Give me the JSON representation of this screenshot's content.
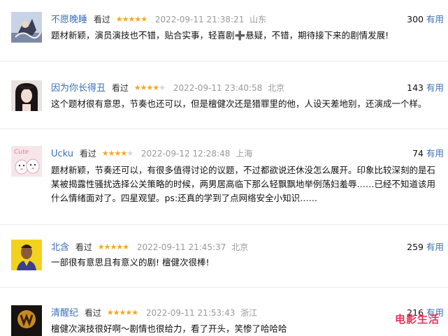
{
  "comments": [
    {
      "user": "不愿晚睡",
      "watched": "看过",
      "rating": 5,
      "time": "2022-09-11 21:38:21",
      "location": "山东",
      "votes": "300",
      "useful": "有用",
      "text_before": "题材新颖，演员演技也不错，贴合实事，轻喜剧",
      "plus": "➕",
      "text_after": "悬疑，不错，期待接下来的剧情发展!"
    },
    {
      "user": "因为你长得丑",
      "watched": "看过",
      "rating": 4,
      "time": "2022-09-11 23:40:58",
      "location": "北京",
      "votes": "143",
      "useful": "有用",
      "text": "这个题材很有意思，节奏也还可以，但是檀健次还是猎罪里的他，人设天差地别，还演成一个样。"
    },
    {
      "user": "Ucku",
      "watched": "看过",
      "rating": 4,
      "time": "2022-09-12 12:28:48",
      "location": "上海",
      "votes": "74",
      "useful": "有用",
      "text": "题材新颖，节奏还可以，有很多值得讨论的议题，不过都欲说还休没怎么展开。印象比较深刻的是石某被揭露性骚扰选择公关策略的时候，两男居高临下那么轻飘飘地举例荡妇羞辱……已经不知道该用什么情绪面对了。四星观望。ps:还真的学到了点网络安全小知识……"
    },
    {
      "user": "北含",
      "watched": "看过",
      "rating": 5,
      "time": "2022-09-11 21:45:37",
      "location": "北京",
      "votes": "259",
      "useful": "有用",
      "text": "一部很有意思且有意义的剧! 檀健次很棒!"
    },
    {
      "user": "清醒纪",
      "watched": "看过",
      "rating": 5,
      "time": "2022-09-11 21:53:43",
      "location": "浙江",
      "votes": "216",
      "useful": "有用",
      "text": "檀健次演技很好啊～剧情也很给力，看了开头，笑惨了哈哈哈"
    }
  ],
  "watermark": "电影生活",
  "colors": {
    "username": "#3b6fb6",
    "star": "#f5a623",
    "star_empty": "#d6d6d6",
    "meta": "#999999",
    "watermark": "#e8325a"
  }
}
